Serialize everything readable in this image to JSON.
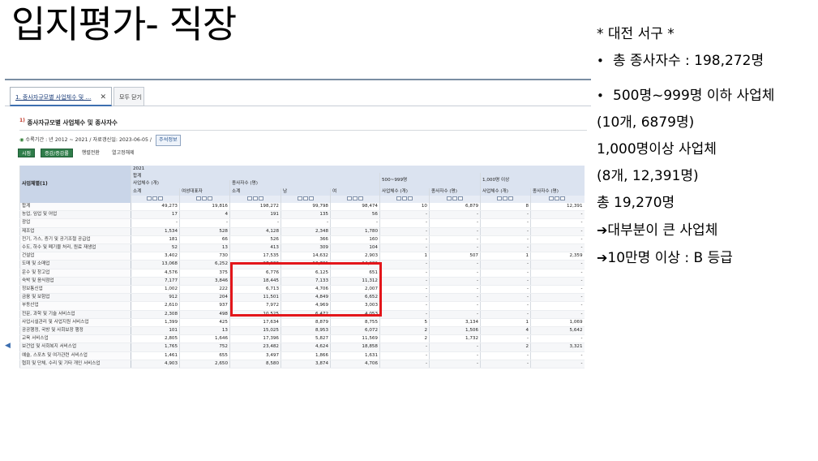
{
  "slide": {
    "title": "입지평가- 직장"
  },
  "notes": {
    "lines": [
      "* 대전 서구 *",
      "총 종사자수 : 198,272명",
      "500명~999명 이하 사업체",
      "(10개, 6879명)",
      "1,000명이상 사업체",
      "(8개, 12,391명)",
      "총 19,270명",
      "대부분이 큰 사업체",
      "10만명 이상 : B 등급"
    ],
    "bullet": "•",
    "arrow": "➔"
  },
  "screenshot": {
    "tabs": {
      "active": "1. 종사자규모별 사업체수 및 …",
      "close_icon": "✕",
      "close_all": "모두 닫기"
    },
    "section_number": "1)",
    "section_title": "종사자규모별 사업체수 및 종사자수",
    "meta_bullet": "◉",
    "meta": "수록기간 : 년 2012 ~ 2021 / 자료갱신일: 2023-06-05 /",
    "note_button": "주석정보",
    "toolbar": {
      "time": "시점",
      "growth": "증감/증감률",
      "swap": "행렬전환",
      "hide_notes": "열고정해제"
    },
    "table": {
      "corner": "사업체별(1)",
      "year": "2021",
      "group_total": "합계",
      "group_500": "500~999명",
      "group_1000": "1,000명 이상",
      "sub_biz": "사업체수 (개)",
      "sub_workers": "종사자수 (명)",
      "leaf_subtotal": "소계",
      "leaf_female_rep": "여성대표자",
      "leaf_male": "남",
      "leaf_female": "여",
      "rows": [
        [
          "합계",
          "49,273",
          "19,816",
          "198,272",
          "99,798",
          "98,474",
          "10",
          "6,879",
          "8",
          "12,391"
        ],
        [
          "농업, 임업 및 어업",
          "17",
          "4",
          "191",
          "135",
          "56",
          "-",
          "-",
          "-",
          "-"
        ],
        [
          "광업",
          "-",
          "-",
          "-",
          "-",
          "-",
          "-",
          "-",
          "-",
          "-"
        ],
        [
          "제조업",
          "1,534",
          "528",
          "4,128",
          "2,348",
          "1,780",
          "-",
          "-",
          "-",
          "-"
        ],
        [
          "전기, 가스, 증기 및 공기조절 공급업",
          "181",
          "66",
          "526",
          "366",
          "160",
          "-",
          "-",
          "-",
          "-"
        ],
        [
          "수도, 하수 및 폐기물 처리, 원료 재생업",
          "52",
          "13",
          "413",
          "309",
          "104",
          "-",
          "-",
          "-",
          "-"
        ],
        [
          "건설업",
          "3,402",
          "730",
          "17,535",
          "14,632",
          "2,903",
          "1",
          "507",
          "1",
          "2,359"
        ],
        [
          "도매 및 소매업",
          "13,068",
          "6,252",
          "27,933",
          "13,731",
          "14,202",
          "-",
          "-",
          "-",
          "-"
        ],
        [
          "운수 및 창고업",
          "4,576",
          "375",
          "6,776",
          "6,125",
          "651",
          "-",
          "-",
          "-",
          "-"
        ],
        [
          "숙박 및 음식점업",
          "7,177",
          "3,846",
          "18,445",
          "7,133",
          "11,312",
          "-",
          "-",
          "-",
          "-"
        ],
        [
          "정보통신업",
          "1,002",
          "222",
          "6,713",
          "4,706",
          "2,007",
          "-",
          "-",
          "-",
          "-"
        ],
        [
          "금융 및 보험업",
          "912",
          "204",
          "11,501",
          "4,849",
          "6,652",
          "-",
          "-",
          "-",
          "-"
        ],
        [
          "부동산업",
          "2,610",
          "937",
          "7,972",
          "4,969",
          "3,003",
          "-",
          "-",
          "-",
          "-"
        ],
        [
          "전문, 과학 및 기술 서비스업",
          "2,308",
          "498",
          "10,525",
          "6,472",
          "4,053",
          "-",
          "-",
          "-",
          "-"
        ],
        [
          "사업시설관리 및 사업지원 서비스업",
          "1,399",
          "425",
          "17,634",
          "8,879",
          "8,755",
          "5",
          "3,134",
          "1",
          "1,069"
        ],
        [
          "공공행정, 국방 및 사회보장 행정",
          "101",
          "13",
          "15,025",
          "8,953",
          "6,072",
          "2",
          "1,506",
          "4",
          "5,642"
        ],
        [
          "교육 서비스업",
          "2,805",
          "1,646",
          "17,396",
          "5,827",
          "11,569",
          "2",
          "1,732",
          "-",
          "-"
        ],
        [
          "보건업 및 사회복지 서비스업",
          "1,765",
          "752",
          "23,482",
          "4,624",
          "18,858",
          "-",
          "-",
          "2",
          "3,321"
        ],
        [
          "예술, 스포츠 및 여가관련 서비스업",
          "1,461",
          "655",
          "3,497",
          "1,866",
          "1,631",
          "-",
          "-",
          "-",
          "-"
        ],
        [
          "협회 및 단체, 수리 및 기타 개인 서비스업",
          "4,903",
          "2,650",
          "8,580",
          "3,874",
          "4,706",
          "-",
          "-",
          "-",
          "-"
        ]
      ]
    }
  }
}
